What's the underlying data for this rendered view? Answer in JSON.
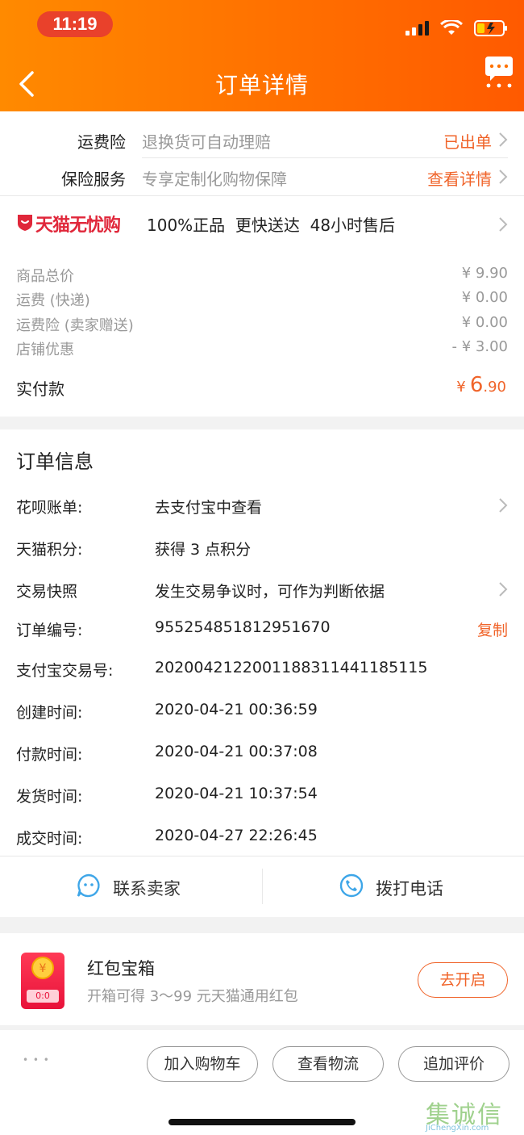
{
  "status_bar": {
    "time": "11:19"
  },
  "header": {
    "title": "订单详情"
  },
  "insurance": [
    {
      "label": "运费险",
      "desc": "退换货可自动理赔",
      "action": "已出单"
    },
    {
      "label": "保险服务",
      "desc": "专享定制化购物保障",
      "action": "查看详情"
    }
  ],
  "guarantee": {
    "brand": "天猫无忧购",
    "text": "100%正品  更快送达  48小时售后"
  },
  "prices": [
    {
      "label": "商品总价",
      "value": "¥ 9.90"
    },
    {
      "label": "运费 (快递)",
      "value": "¥ 0.00"
    },
    {
      "label": "运费险 (卖家赠送)",
      "value": "¥ 0.00"
    },
    {
      "label": "店铺优惠",
      "value": "- ¥ 3.00"
    }
  ],
  "paid": {
    "label": "实付款",
    "currency": "¥",
    "integer": "6",
    "decimal": ".90"
  },
  "order_info": {
    "title": "订单信息",
    "rows": [
      {
        "label": "花呗账单:",
        "value": "去支付宝中查看"
      },
      {
        "label": "天猫积分:",
        "value": "获得 3 点积分"
      },
      {
        "label": "交易快照",
        "value": "发生交易争议时，可作为判断依据"
      },
      {
        "label": "订单编号:",
        "value": "955254851812951670",
        "action": "复制"
      },
      {
        "label": "支付宝交易号:",
        "value": "2020042122001188311441185115"
      },
      {
        "label": "创建时间:",
        "value": "2020-04-21 00:36:59"
      },
      {
        "label": "付款时间:",
        "value": "2020-04-21 00:37:08"
      },
      {
        "label": "发货时间:",
        "value": "2020-04-21 10:37:54"
      },
      {
        "label": "成交时间:",
        "value": "2020-04-27 22:26:45"
      }
    ]
  },
  "contact": {
    "seller": "联系卖家",
    "phone": "拨打电话"
  },
  "redpack": {
    "title": "红包宝箱",
    "desc": "开箱可得 3～99 元天猫通用红包",
    "button": "去开启",
    "box_code": "0:0"
  },
  "bottom_bar": {
    "more": "• • •",
    "add_cart": "加入购物车",
    "logistics": "查看物流",
    "review": "追加评价"
  },
  "watermark": {
    "text_cn": "集诚信",
    "text_en": "JiChengXin.com"
  },
  "colors": {
    "accent": "#f0642a",
    "header_start": "#ff8a00",
    "header_end": "#ff5a00",
    "tmall_red": "#e0273a"
  }
}
